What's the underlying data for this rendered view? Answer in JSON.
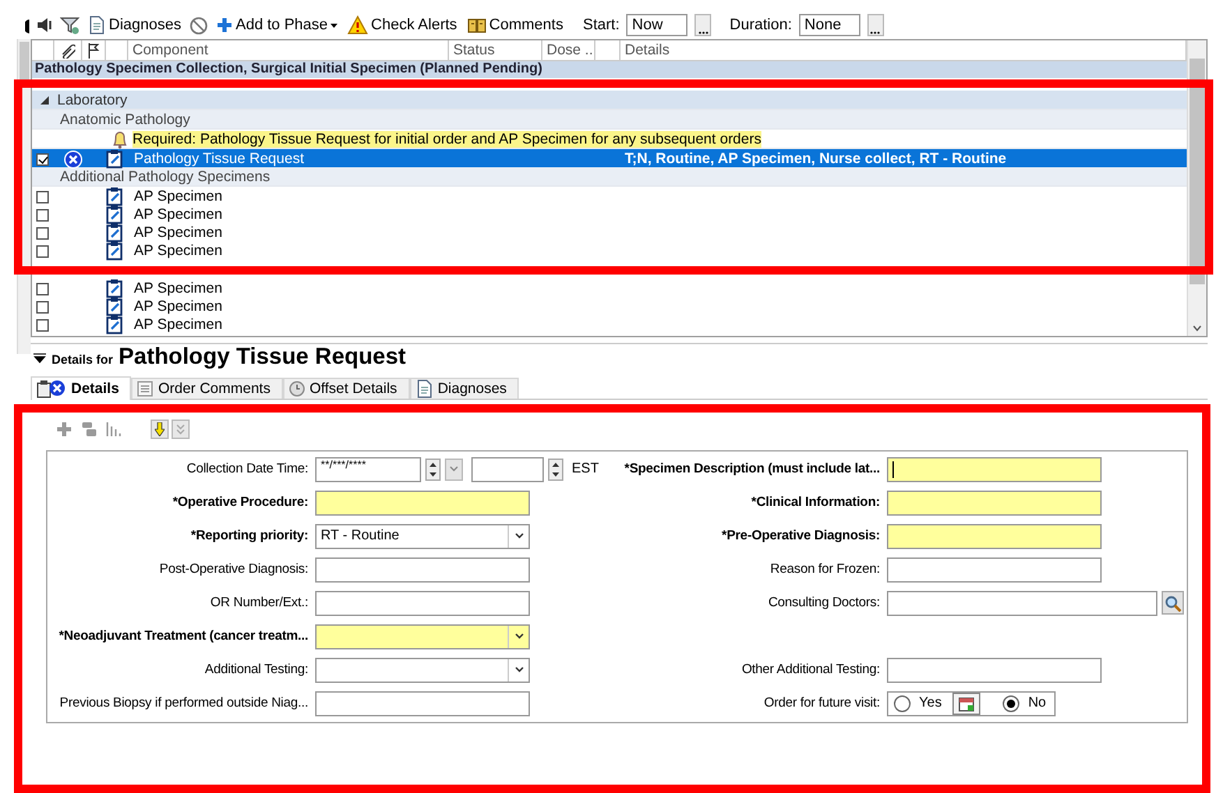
{
  "toolbar": {
    "buttons": [
      {
        "label": "Diagnoses",
        "menu": false
      },
      {
        "label": "Add to Phase",
        "menu": true
      },
      {
        "label": "Check Alerts",
        "menu": false
      },
      {
        "label": "Comments",
        "menu": false
      }
    ],
    "start": {
      "label": "Start:",
      "value": "Now"
    },
    "duration": {
      "label": "Duration:",
      "value": "None"
    }
  },
  "grid": {
    "columns": [
      "Component",
      "Status",
      "Dose ...",
      "Details"
    ],
    "phase": "Pathology Specimen Collection, Surgical Initial Specimen (Planned Pending)",
    "rows": [
      {
        "kind": "category",
        "text": "Laboratory",
        "expanded": true
      },
      {
        "kind": "subcategory",
        "text": "Anatomic Pathology"
      },
      {
        "kind": "note",
        "text": "Required: Pathology Tissue Request for initial order and AP Specimen for any subsequent orders"
      },
      {
        "kind": "order",
        "component": "Pathology Tissue Request",
        "details": "T;N, Routine, AP Specimen, Nurse collect, RT - Routine",
        "checked": true,
        "selected": true,
        "missing_details": true
      },
      {
        "kind": "subcategory",
        "text": "Additional Pathology Specimens"
      },
      {
        "kind": "order",
        "component": "AP Specimen",
        "checked": false,
        "selected": false,
        "missing_details": false
      },
      {
        "kind": "order",
        "component": "AP Specimen",
        "checked": false,
        "selected": false,
        "missing_details": false
      },
      {
        "kind": "order",
        "component": "AP Specimen",
        "checked": false,
        "selected": false,
        "missing_details": false
      },
      {
        "kind": "order",
        "component": "AP Specimen",
        "checked": false,
        "selected": false,
        "missing_details": false
      },
      {
        "kind": "hidden"
      },
      {
        "kind": "order",
        "component": "AP Specimen",
        "checked": false,
        "selected": false,
        "missing_details": false
      },
      {
        "kind": "order",
        "component": "AP Specimen",
        "checked": false,
        "selected": false,
        "missing_details": false
      },
      {
        "kind": "order",
        "component": "AP Specimen",
        "checked": false,
        "selected": false,
        "missing_details": false
      }
    ]
  },
  "details": {
    "prefix": "Details for",
    "title": "Pathology Tissue Request",
    "tabs": [
      {
        "label": "Details",
        "selected": true
      },
      {
        "label": "Order Comments",
        "selected": false
      },
      {
        "label": "Offset Details",
        "selected": false
      },
      {
        "label": "Diagnoses",
        "selected": false
      }
    ],
    "form": {
      "rows": [
        {
          "left": {
            "label": "Collection Date  Time:",
            "kind": "datetime",
            "required": false,
            "value": "**/***/****",
            "timezone": "EST"
          },
          "right": {
            "label": "*Specimen Description (must include lat...",
            "kind": "text",
            "required": true,
            "focused": true
          }
        },
        {
          "left": {
            "label": "*Operative Procedure:",
            "kind": "text",
            "required": true
          },
          "right": {
            "label": "*Clinical Information:",
            "kind": "text",
            "required": true
          }
        },
        {
          "left": {
            "label": "*Reporting priority:",
            "kind": "dropdown",
            "required": true,
            "value": "RT - Routine"
          },
          "right": {
            "label": "*Pre-Operative Diagnosis:",
            "kind": "text",
            "required": true
          }
        },
        {
          "left": {
            "label": "Post-Operative Diagnosis:",
            "kind": "text",
            "required": false
          },
          "right": {
            "label": "Reason for Frozen:",
            "kind": "text",
            "required": false
          }
        },
        {
          "left": {
            "label": "OR Number/Ext.:",
            "kind": "text",
            "required": false
          },
          "right": {
            "label": "Consulting Doctors:",
            "kind": "lookup",
            "required": false
          }
        },
        {
          "left": {
            "label": "*Neoadjuvant Treatment (cancer treatm...",
            "kind": "dropdown",
            "required": true
          }
        },
        {
          "left": {
            "label": "Additional Testing:",
            "kind": "dropdown",
            "required": false
          },
          "right": {
            "label": "Other Additional Testing:",
            "kind": "text",
            "required": false
          }
        },
        {
          "left": {
            "label": "Previous Biopsy if performed outside Niag...",
            "kind": "text",
            "required": false
          },
          "right": {
            "label": "Order for future visit:",
            "kind": "radio",
            "required": false,
            "options": [
              {
                "label": "Yes",
                "selected": false
              },
              {
                "label": "No",
                "selected": true
              }
            ]
          }
        }
      ]
    }
  }
}
